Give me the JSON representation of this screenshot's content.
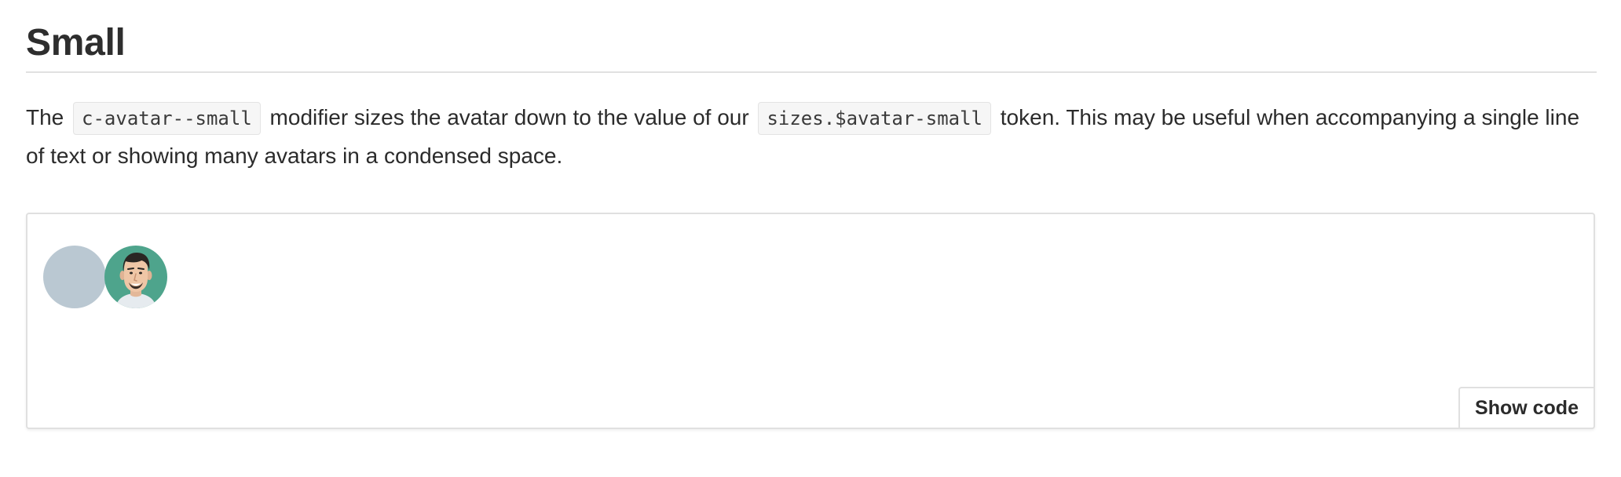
{
  "section": {
    "heading": "Small"
  },
  "description": {
    "text_1": "The ",
    "code_1": "c-avatar--small",
    "text_2": " modifier sizes the avatar down to the value of our ",
    "code_2": "sizes.$avatar-small",
    "text_3": " token. This may be useful when accompanying a single line of text or showing many avatars in a condensed space."
  },
  "demo": {
    "avatars": [
      {
        "kind": "placeholder",
        "color": "#bac8d2"
      },
      {
        "kind": "photo",
        "background": "#4ea48c",
        "icon": "person-photo"
      }
    ],
    "show_code_label": "Show code"
  },
  "colors": {
    "text": "#2b2b2b",
    "rule": "#e1e1e1",
    "code_bg": "#f6f6f6",
    "panel_border": "#e0e0e0"
  }
}
